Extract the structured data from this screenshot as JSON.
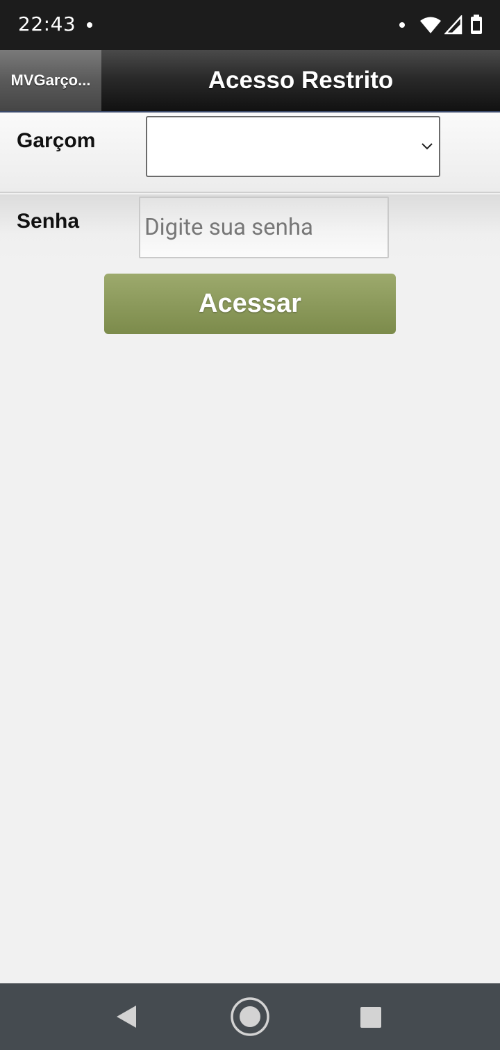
{
  "status_bar": {
    "time": "22:43",
    "icons": [
      "notification-dot-icon",
      "wifi-icon",
      "signal-icon",
      "battery-icon"
    ]
  },
  "header": {
    "back_label": "MVGarço...",
    "title": "Acesso Restrito"
  },
  "form": {
    "garcom_label": "Garçom",
    "garcom_value": "",
    "senha_label": "Senha",
    "senha_placeholder": "Digite sua senha",
    "submit_label": "Acessar"
  },
  "nav_bar": {
    "icons": [
      "back-triangle-icon",
      "home-circle-icon",
      "recents-square-icon"
    ]
  },
  "colors": {
    "status_bar": "#1c1c1c",
    "header": "#2a2a2a",
    "button": "#8c9a5c",
    "background": "#f1f1f1",
    "nav_bar": "#454b50"
  }
}
